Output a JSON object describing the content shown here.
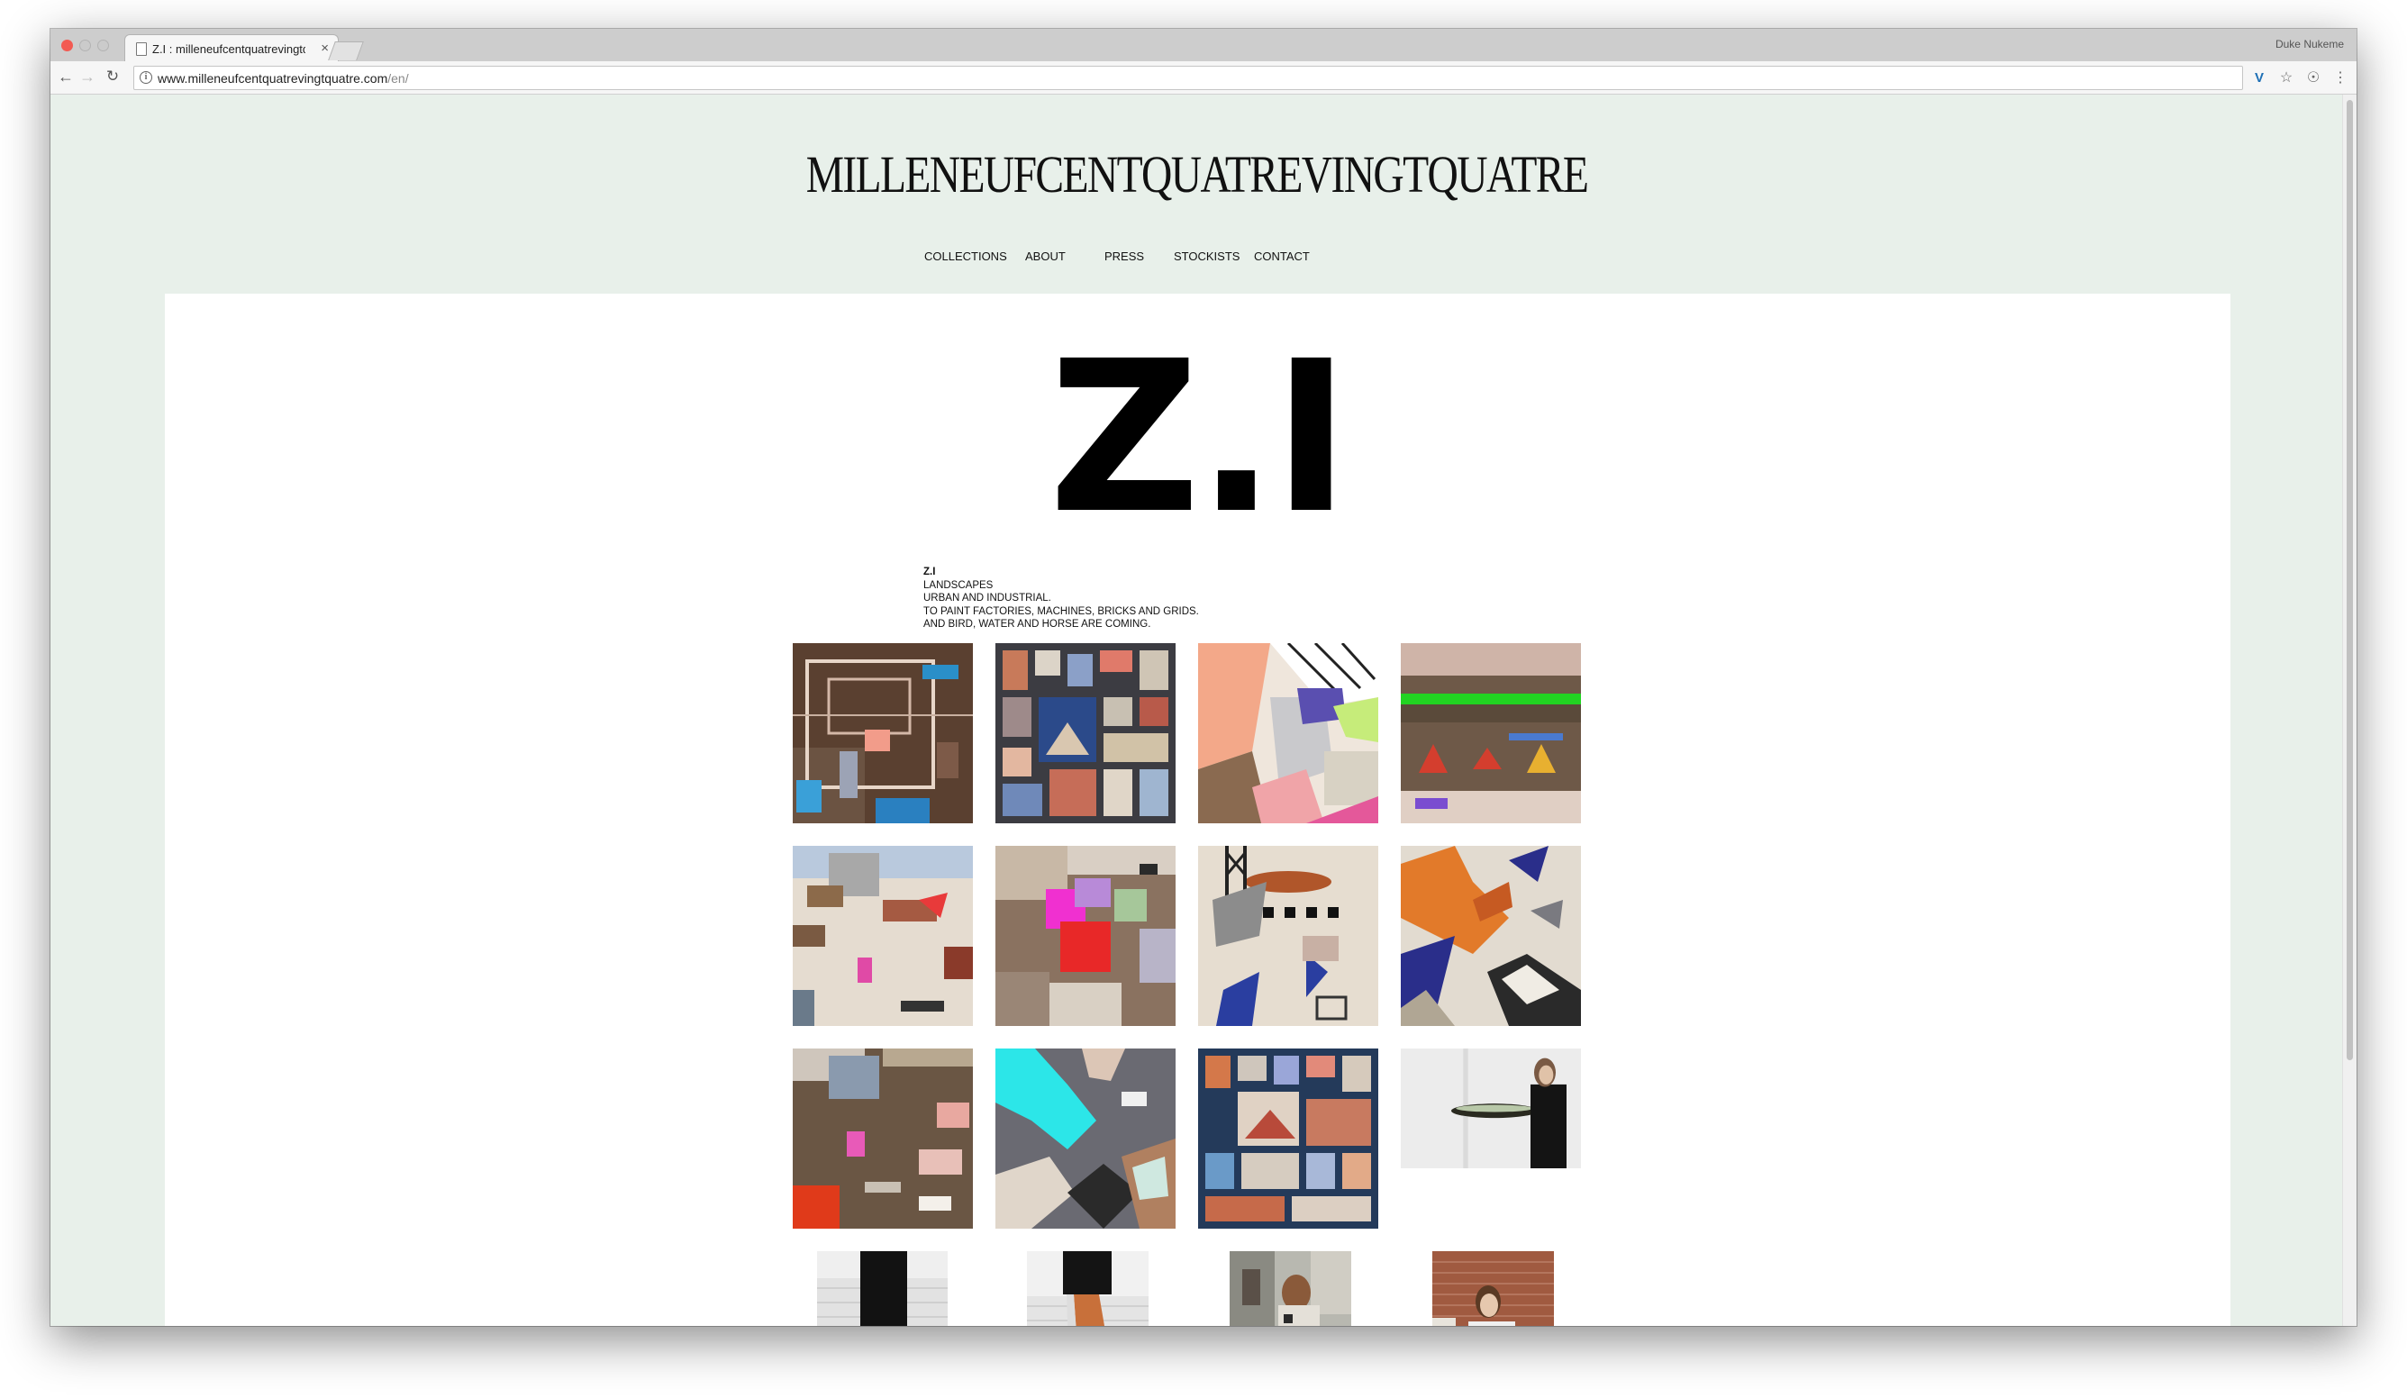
{
  "browser": {
    "tab_title": "Z.I : milleneufcentquatrevingtquatre",
    "tab_close": "×",
    "profile_name": "Duke Nukeme",
    "url_domain": "www.milleneufcentquatrevingtquatre.com",
    "url_path": "/en/",
    "icons": [
      "back-arrow-icon",
      "forward-arrow-icon",
      "reload-icon",
      "info-icon",
      "vimeo-extension-icon",
      "star-icon",
      "shield-extension-icon",
      "menu-icon"
    ]
  },
  "site": {
    "logo": "MILLENEUFCENTQUATREVINGTQUATRE",
    "nav": [
      "COLLECTIONS",
      "ABOUT",
      "PRESS",
      "STOCKISTS",
      "CONTACT"
    ],
    "colors": {
      "page_bg": "#e8f0ea",
      "content_bg": "#ffffff",
      "text": "#111111"
    }
  },
  "collection": {
    "title": "Z.I",
    "description": {
      "heading": "Z.I",
      "lines": [
        "LANDSCAPES",
        "URBAN AND INDUSTRIAL.",
        "TO PAINT FACTORIES, MACHINES, BRICKS AND GRIDS.",
        "AND BIRD, WATER AND HORSE ARE COMING."
      ]
    },
    "gallery_count": 16
  }
}
